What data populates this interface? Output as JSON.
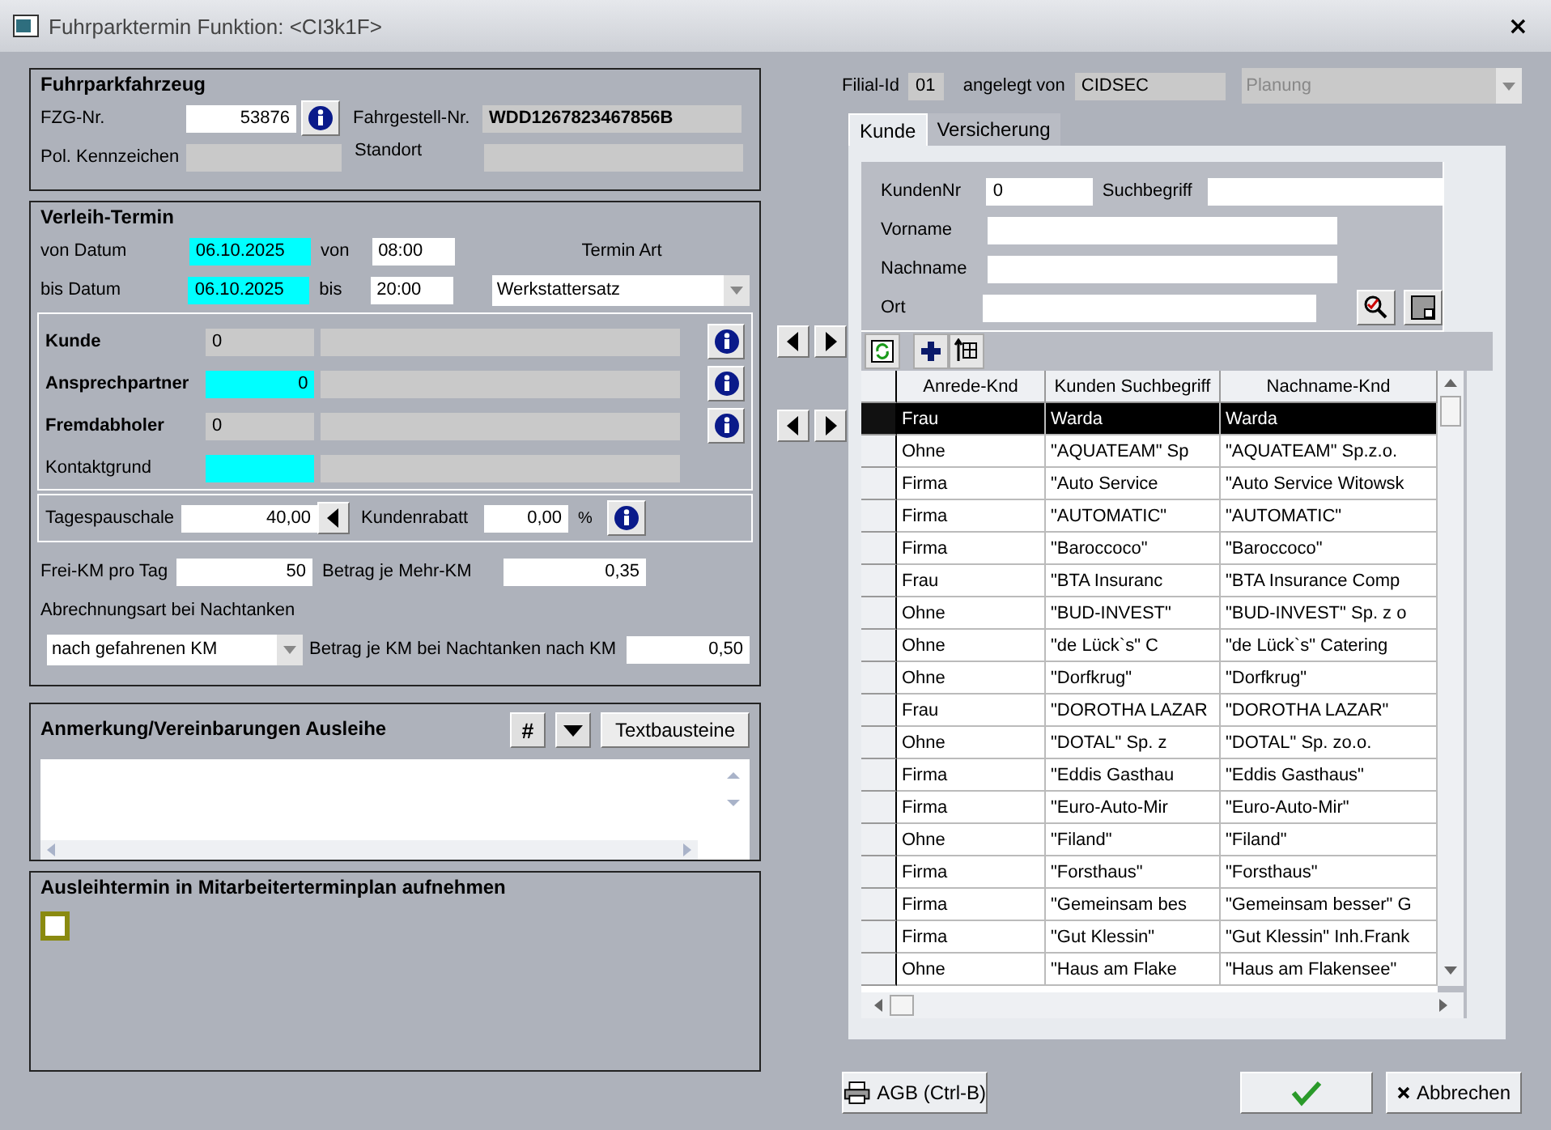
{
  "window": {
    "title": "Fuhrparktermin Funktion: <CI3k1F>",
    "close": "×"
  },
  "vehicle": {
    "title": "Fuhrparkfahrzeug",
    "fzg_label": "FZG-Nr.",
    "fzg_value": "53876",
    "chassis_label": "Fahrgestell-Nr.",
    "chassis_value": "WDD1267823467856B",
    "plate_label": "Pol. Kennzeichen",
    "location_label": "Standort"
  },
  "booking": {
    "title": "Verleih-Termin",
    "from_date_label": "von Datum",
    "from_date": "06.10.2025",
    "from_time_label": "von",
    "from_time": "08:00",
    "type_label": "Termin Art",
    "to_date_label": "bis Datum",
    "to_date": "06.10.2025",
    "to_time_label": "bis",
    "to_time": "20:00",
    "type_value": "Werkstattersatz",
    "persons": [
      {
        "label": "Kunde",
        "bold": true,
        "value": "0",
        "highlighted": false,
        "info": true,
        "arrows": true
      },
      {
        "label": "Ansprechpartner",
        "bold": true,
        "value": "0",
        "highlighted": true,
        "info": true,
        "arrows": false
      },
      {
        "label": "Fremdabholer",
        "bold": true,
        "value": "0",
        "highlighted": false,
        "info": true,
        "arrows": true
      },
      {
        "label": "Kontaktgrund",
        "bold": false,
        "highlighted": true,
        "info": false,
        "arrows": false
      }
    ],
    "daily_label": "Tagespauschale",
    "daily_value": "40,00",
    "discount_label": "Kundenrabatt",
    "discount_value": "0,00",
    "percent": "%",
    "free_km_label": "Frei-KM pro Tag",
    "free_km_value": "50",
    "extra_km_label": "Betrag je Mehr-KM",
    "extra_km_value": "0,35",
    "refuel_label": "Abrechnungsart bei Nachtanken",
    "refuel_mode": "nach gefahrenen KM",
    "refuel_rate_label": "Betrag je KM bei Nachtanken nach KM",
    "refuel_rate_value": "0,50"
  },
  "notes": {
    "title": "Anmerkung/Vereinbarungen Ausleihe",
    "hash_button": "#",
    "text_blocks_button": "Textbausteine"
  },
  "plan": {
    "title": "Ausleihtermin in Mitarbeiterterminplan aufnehmen",
    "checked": false
  },
  "header": {
    "branch_label": "Filial-Id",
    "branch": "01",
    "created_label": "angelegt von",
    "created_by": "CIDSEC",
    "status": "Planung"
  },
  "tabs": [
    {
      "label": "Kunde",
      "selected": true
    },
    {
      "label": "Versicherung",
      "selected": false
    }
  ],
  "search": [
    {
      "label": "KundenNr",
      "value": "0"
    },
    {
      "label": "Suchbegriff"
    },
    {
      "label": "Vorname"
    },
    {
      "label": "Nachname"
    },
    {
      "label": "Ort"
    }
  ],
  "table": {
    "columns": [
      "Anrede-Knd",
      "Kunden Suchbegriff",
      "Nachname-Knd"
    ],
    "rows": [
      {
        "cells": [
          "Frau",
          "Warda",
          "Warda"
        ],
        "selected": true
      },
      {
        "cells": [
          "Ohne",
          "\"AQUATEAM\" Sp",
          "\"AQUATEAM\" Sp.z.o."
        ],
        "selected": false
      },
      {
        "cells": [
          "Firma",
          "\"Auto Service",
          "\"Auto Service Witowsk"
        ],
        "selected": false
      },
      {
        "cells": [
          "Firma",
          "\"AUTOMATIC\"",
          "\"AUTOMATIC\""
        ],
        "selected": false
      },
      {
        "cells": [
          "Firma",
          "\"Baroccoco\"",
          "\"Baroccoco\""
        ],
        "selected": false
      },
      {
        "cells": [
          "Frau",
          "\"BTA  Insuranc",
          "\"BTA  Insurance Comp"
        ],
        "selected": false
      },
      {
        "cells": [
          "Ohne",
          "\"BUD-INVEST\"",
          "\"BUD-INVEST\" Sp. z o"
        ],
        "selected": false
      },
      {
        "cells": [
          "Ohne",
          "\"de Lück`s\" C",
          "\"de Lück`s\" Catering"
        ],
        "selected": false
      },
      {
        "cells": [
          "Ohne",
          "\"Dorfkrug\"",
          "\"Dorfkrug\""
        ],
        "selected": false
      },
      {
        "cells": [
          "Frau",
          "\"DOROTHA LAZAR",
          "\"DOROTHA LAZAR\""
        ],
        "selected": false
      },
      {
        "cells": [
          "Ohne",
          "\"DOTAL\" Sp. z",
          "\"DOTAL\" Sp. zo.o."
        ],
        "selected": false
      },
      {
        "cells": [
          "Firma",
          "\"Eddis Gasthau",
          "\"Eddis Gasthaus\""
        ],
        "selected": false
      },
      {
        "cells": [
          "Firma",
          "\"Euro-Auto-Mir",
          "\"Euro-Auto-Mir\""
        ],
        "selected": false
      },
      {
        "cells": [
          "Ohne",
          "\"Filand\"",
          "\"Filand\""
        ],
        "selected": false
      },
      {
        "cells": [
          "Firma",
          "\"Forsthaus\"",
          "\"Forsthaus\""
        ],
        "selected": false
      },
      {
        "cells": [
          "Firma",
          "\"Gemeinsam bes",
          "\"Gemeinsam besser\" G"
        ],
        "selected": false
      },
      {
        "cells": [
          "Firma",
          "\"Gut Klessin\"",
          "\"Gut Klessin\" Inh.Frank"
        ],
        "selected": false
      },
      {
        "cells": [
          "Ohne",
          "\"Haus am Flake",
          "\"Haus am Flakensee\""
        ],
        "selected": false
      }
    ]
  },
  "footer": {
    "agb_button": "AGB (Ctrl-B)",
    "cancel_button": "Abbrechen"
  }
}
